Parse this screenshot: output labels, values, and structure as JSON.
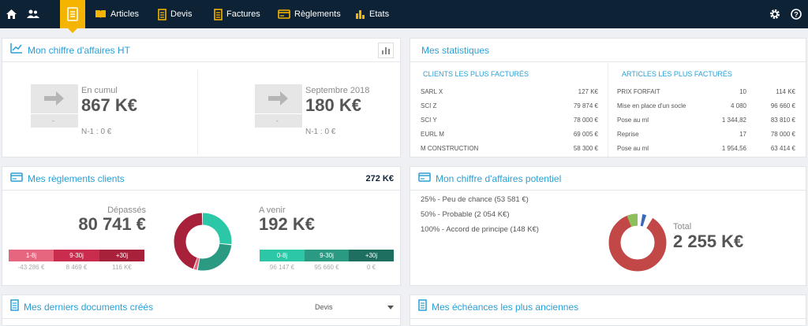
{
  "nav": {
    "items": [
      {
        "label": "Articles"
      },
      {
        "label": "Devis"
      },
      {
        "label": "Factures"
      },
      {
        "label": "Règlements"
      },
      {
        "label": "Etats"
      }
    ]
  },
  "ca": {
    "title": "Mon chiffre d'affaires HT",
    "cumul_label": "En cumul",
    "cumul_value": "867 K€",
    "cumul_n1": "N-1 : 0 €",
    "cumul_dash": "-",
    "month_label": "Septembre 2018",
    "month_value": "180 K€",
    "month_n1": "N-1 : 0 €",
    "month_dash": "-"
  },
  "stats": {
    "title": "Mes statistiques",
    "clients_title": "CLIENTS LES PLUS FACTURÉS",
    "clients": [
      {
        "name": "SARL X",
        "value": "127 K€"
      },
      {
        "name": "SCI Z",
        "value": "79 874 €"
      },
      {
        "name": "SCI Y",
        "value": "78 000 €"
      },
      {
        "name": "EURL M",
        "value": "69 005 €"
      },
      {
        "name": "M CONSTRUCTION",
        "value": "58 300 €"
      }
    ],
    "articles_title": "ARTICLES LES PLUS FACTURÉS",
    "articles": [
      {
        "name": "PRIX FORFAIT",
        "qty": "10",
        "value": "114 K€"
      },
      {
        "name": "Mise en place d'un socle",
        "qty": "4 080",
        "value": "96 660 €"
      },
      {
        "name": "Pose au ml",
        "qty": "1 344,82",
        "value": "83 810 €"
      },
      {
        "name": "Reprise",
        "qty": "17",
        "value": "78 000 €"
      },
      {
        "name": "Pose au ml",
        "qty": "1 954,56",
        "value": "63 414 €"
      }
    ]
  },
  "reglements": {
    "title": "Mes règlements clients",
    "total": "272 K€",
    "depasses_label": "Dépassés",
    "depasses_value": "80 741 €",
    "avenir_label": "A venir",
    "avenir_value": "192 K€",
    "depasses_segments": [
      {
        "label": "1-8j",
        "value": "-43 286 €"
      },
      {
        "label": "9-30j",
        "value": "8 469 €"
      },
      {
        "label": "+30j",
        "value": "116 K€"
      }
    ],
    "avenir_segments": [
      {
        "label": "0-8j",
        "value": "96 147 €"
      },
      {
        "label": "9-30j",
        "value": "95 660 €"
      },
      {
        "label": "+30j",
        "value": "0 €"
      }
    ]
  },
  "potentiel": {
    "title": "Mon chiffre d'affaires potentiel",
    "lines": [
      "25% - Peu de chance (53 581 €)",
      "50% - Probable (2 054 K€)",
      "100% - Accord de principe (148 K€)"
    ],
    "total_label": "Total",
    "total_value": "2 255 K€"
  },
  "documents": {
    "title": "Mes derniers documents créés",
    "select_value": "Devis"
  },
  "echeances": {
    "title": "Mes échéances les plus anciennes"
  },
  "colors": {
    "topbar": "#0e2235",
    "accent": "#2a9fd6",
    "active": "#f4b400",
    "red_dark": "#a8213a",
    "red": "#c92c4c",
    "pink": "#e6667f",
    "teal": "#2bc7a6",
    "teal_mid": "#2a9b82",
    "teal_dark": "#1f6f60",
    "pie_red": "#c24747",
    "pie_green": "#8dc05a",
    "pie_blue": "#3a6ab7"
  }
}
